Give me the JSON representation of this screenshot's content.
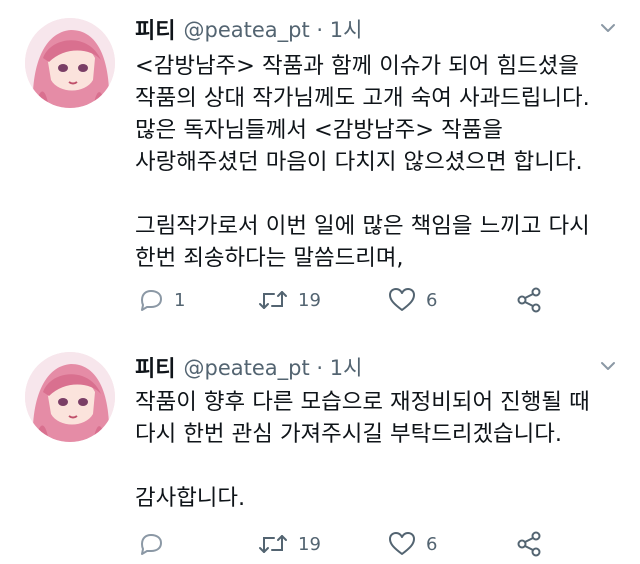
{
  "tweets": [
    {
      "author": {
        "display_name": "피티",
        "handle_time": "@peatea_pt · 1시"
      },
      "lines": [
        "<감방남주> 작품과 함께 이슈가 되어 힘드셨을",
        "작품의 상대 작가님께도 고개 숙여 사과드립니다.",
        "많은 독자님들께서 <감방남주> 작품을",
        "사랑해주셨던 마음이 다치지 않으셨으면 합니다.",
        "",
        "그림작가로서 이번 일에 많은 책임을 느끼고 다시",
        "한번 죄송하다는 말씀드리며,"
      ],
      "actions": {
        "reply_count": "1",
        "retweet_count": "19",
        "like_count": "6",
        "share_count": ""
      }
    },
    {
      "author": {
        "display_name": "피티",
        "handle_time": "@peatea_pt · 1시"
      },
      "lines": [
        "작품이 향후 다른 모습으로 재정비되어 진행될 때",
        "다시 한번 관심 가져주시길 부탁드리겠습니다.",
        "",
        "감사합니다."
      ],
      "actions": {
        "reply_count": "",
        "retweet_count": "19",
        "like_count": "6",
        "share_count": ""
      }
    }
  ],
  "icons": [
    "caret-down-icon",
    "reply-icon",
    "retweet-icon",
    "like-icon",
    "share-icon"
  ],
  "colors": {
    "text": "#0f1419",
    "secondary": "#536471",
    "icon": "#536471",
    "background": "#ffffff"
  }
}
